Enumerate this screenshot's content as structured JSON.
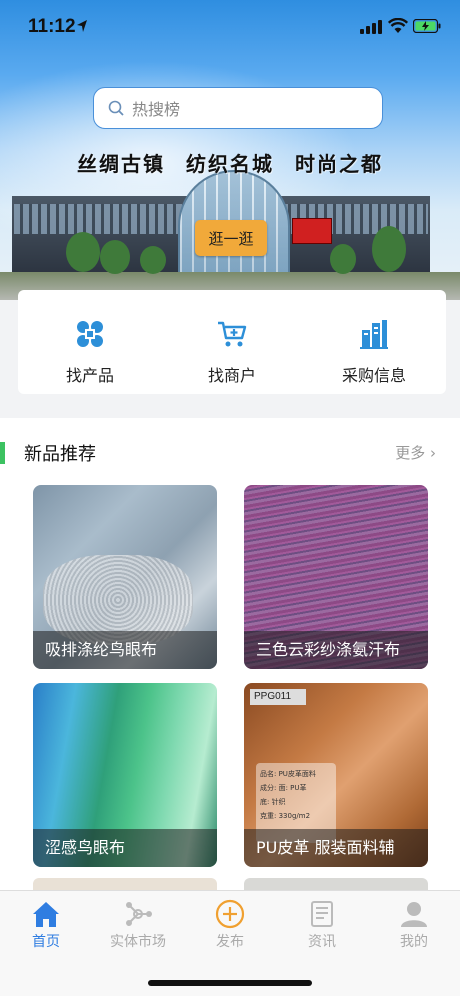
{
  "status_bar": {
    "time": "11:12"
  },
  "search": {
    "placeholder": "热搜榜"
  },
  "banner": {
    "slogan": "丝绸古镇 纺织名城 时尚之都",
    "stroll_button": "逛一逛"
  },
  "quick_nav": [
    {
      "label": "找产品",
      "icon": "grid-knot-icon"
    },
    {
      "label": "找商户",
      "icon": "cart-plus-icon"
    },
    {
      "label": "采购信息",
      "icon": "buildings-icon"
    }
  ],
  "new_products": {
    "title": "新品推荐",
    "more_label": "更多",
    "items": [
      {
        "caption": "吸排涤纶鸟眼布"
      },
      {
        "caption": "三色云彩纱涤氨汗布"
      },
      {
        "caption": "涩感鸟眼布"
      },
      {
        "caption": "PU皮革 服装面料辅"
      }
    ],
    "swatch_text": {
      "code": "PPG011",
      "line1": "品名: PU皮革面料",
      "line2": "成分: 面: PU革",
      "line3": "底: 针织",
      "line4": "克重: 330g/m2"
    }
  },
  "tab_bar": [
    {
      "label": "首页",
      "icon": "home-icon",
      "active": true
    },
    {
      "label": "实体市场",
      "icon": "nodes-icon",
      "active": false
    },
    {
      "label": "发布",
      "icon": "plus-circle-icon",
      "active": false
    },
    {
      "label": "资讯",
      "icon": "news-icon",
      "active": false
    },
    {
      "label": "我的",
      "icon": "user-icon",
      "active": false
    }
  ],
  "colors": {
    "accent_blue": "#2f7de1",
    "section_green": "#3cc261",
    "stroll_orange": "#f1a93a",
    "publish_orange": "#f0a030"
  }
}
